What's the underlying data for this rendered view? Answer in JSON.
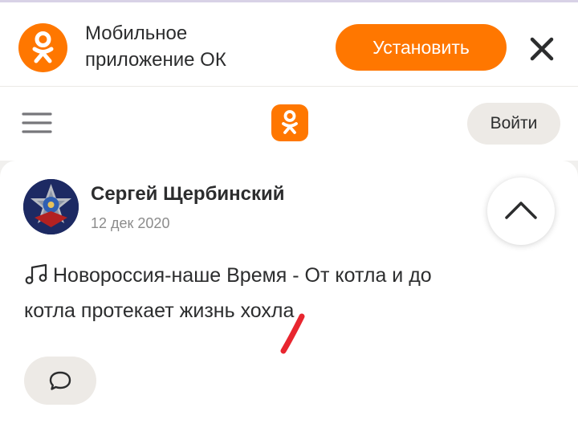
{
  "banner": {
    "title_line1": "Мобильное",
    "title_line2": "приложение ОК",
    "install_label": "Установить"
  },
  "header": {
    "login_label": "Войти"
  },
  "post": {
    "author": "Сергей Щербинский",
    "date": "12 дек 2020",
    "text_line1": "Новороссия-наше Время - От котла и до",
    "text_line2": "котла протекает жизнь хохла"
  },
  "icons": {
    "banner_logo": "ok-logo-icon",
    "close": "close-icon",
    "menu": "hamburger-menu-icon",
    "header_logo": "ok-logo-icon",
    "scroll_up": "chevron-up-icon",
    "music": "music-note-icon",
    "comment": "comment-bubble-icon"
  },
  "colors": {
    "brand_orange": "#ff7700",
    "text_primary": "#2c2d2e",
    "text_secondary": "#8c8c8c",
    "button_gray": "#edeae6",
    "page_background": "#f1f0ee",
    "annotation_red": "#e8262f"
  }
}
